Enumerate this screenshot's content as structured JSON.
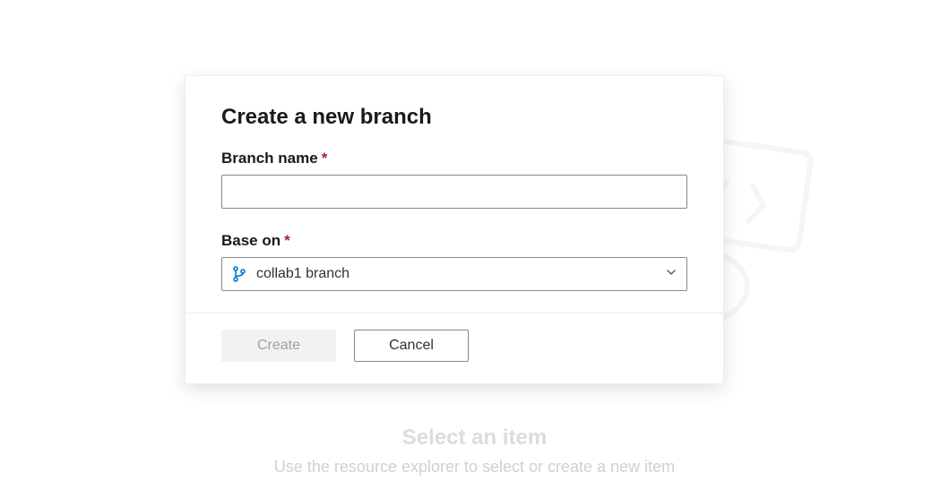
{
  "background": {
    "title": "Select an item",
    "subtitle": "Use the resource explorer to select or create a new item"
  },
  "dialog": {
    "title": "Create a new branch",
    "branchName": {
      "label": "Branch name",
      "value": ""
    },
    "baseOn": {
      "label": "Base on",
      "selected": "collab1 branch"
    },
    "buttons": {
      "create": "Create",
      "cancel": "Cancel"
    }
  }
}
